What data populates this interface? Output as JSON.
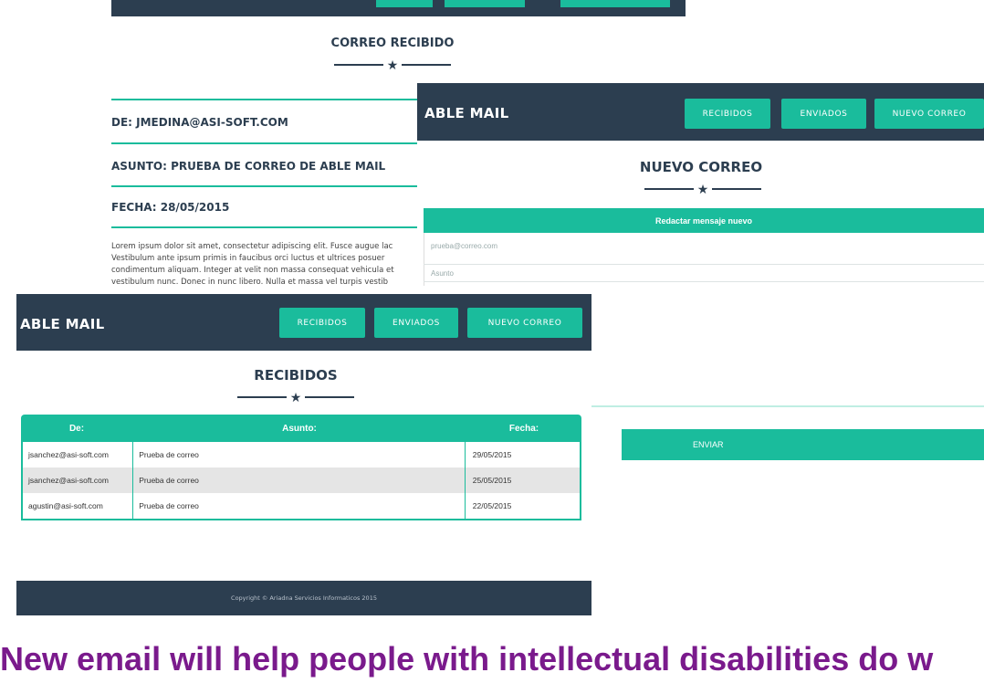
{
  "panel_recibido": {
    "title": "CORREO RECIBIDO",
    "from": "DE: JMEDINA@ASI-SOFT.COM",
    "subject": "ASUNTO: PRUEBA DE CORREO DE ABLE MAIL",
    "date": "FECHA: 28/05/2015",
    "body_lines": [
      "Lorem ipsum dolor sit amet, consectetur adipiscing elit. Fusce augue lac",
      "Vestibulum ante ipsum primis in faucibus orci luctus et ultrices posuer",
      "condimentum aliquam. Integer at velit non massa consequat vehicula et",
      "vestibulum nunc. Donec in nunc libero. Nulla et massa vel turpis vestib"
    ]
  },
  "panel_nuevo": {
    "brand": "ABLE MAIL",
    "nav": [
      "RECIBIDOS",
      "ENVIADOS",
      "NUEVO CORREO"
    ],
    "title": "NUEVO CORREO",
    "compose_header": "Redactar mensaje nuevo",
    "to_placeholder": "prueba@correo.com",
    "subject_placeholder": "Asunto",
    "send_label": "ENVIAR"
  },
  "panel_recibidos": {
    "brand": "ABLE MAIL",
    "nav": [
      "RECIBIDOS",
      "ENVIADOS",
      "NUEVO CORREO"
    ],
    "title": "RECIBIDOS",
    "columns": [
      "De:",
      "Asunto:",
      "Fecha:"
    ],
    "rows": [
      {
        "from": "jsanchez@asi-soft.com",
        "subject": "Prueba de correo",
        "date": "29/05/2015"
      },
      {
        "from": "jsanchez@asi-soft.com",
        "subject": "Prueba de correo",
        "date": "25/05/2015"
      },
      {
        "from": "agustin@asi-soft.com",
        "subject": "Prueba de correo",
        "date": "22/05/2015"
      }
    ],
    "footer": "Copyright © Ariadna Servicios Informaticos 2015"
  },
  "caption": "New email will help people with intellectual disabilities do w",
  "colors": {
    "navy": "#2c3e50",
    "teal": "#1abc9c",
    "caption": "#7a1a8c"
  }
}
